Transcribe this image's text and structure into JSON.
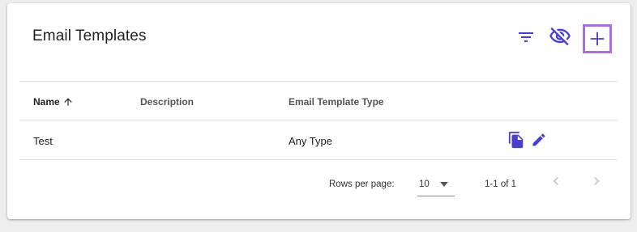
{
  "header": {
    "title": "Email Templates"
  },
  "toolbar": {
    "filter_icon": "filter-list-icon",
    "visibility_icon": "visibility-off-icon",
    "add_icon": "plus-icon"
  },
  "table": {
    "columns": [
      {
        "label": "Name",
        "sort": "ascending"
      },
      {
        "label": "Description"
      },
      {
        "label": "Email Template Type"
      }
    ],
    "rows": [
      {
        "name": "Test",
        "description": "",
        "type": "Any Type",
        "actions": [
          "copy-icon",
          "edit-icon"
        ]
      }
    ]
  },
  "pagination": {
    "rows_per_page_label": "Rows per page:",
    "rows_per_page_value": "10",
    "range_text": "1-1 of 1"
  },
  "colors": {
    "accent": "#4a3fcf",
    "focus_outline": "#a970dc",
    "disabled_nav": "#c4c4c4"
  }
}
